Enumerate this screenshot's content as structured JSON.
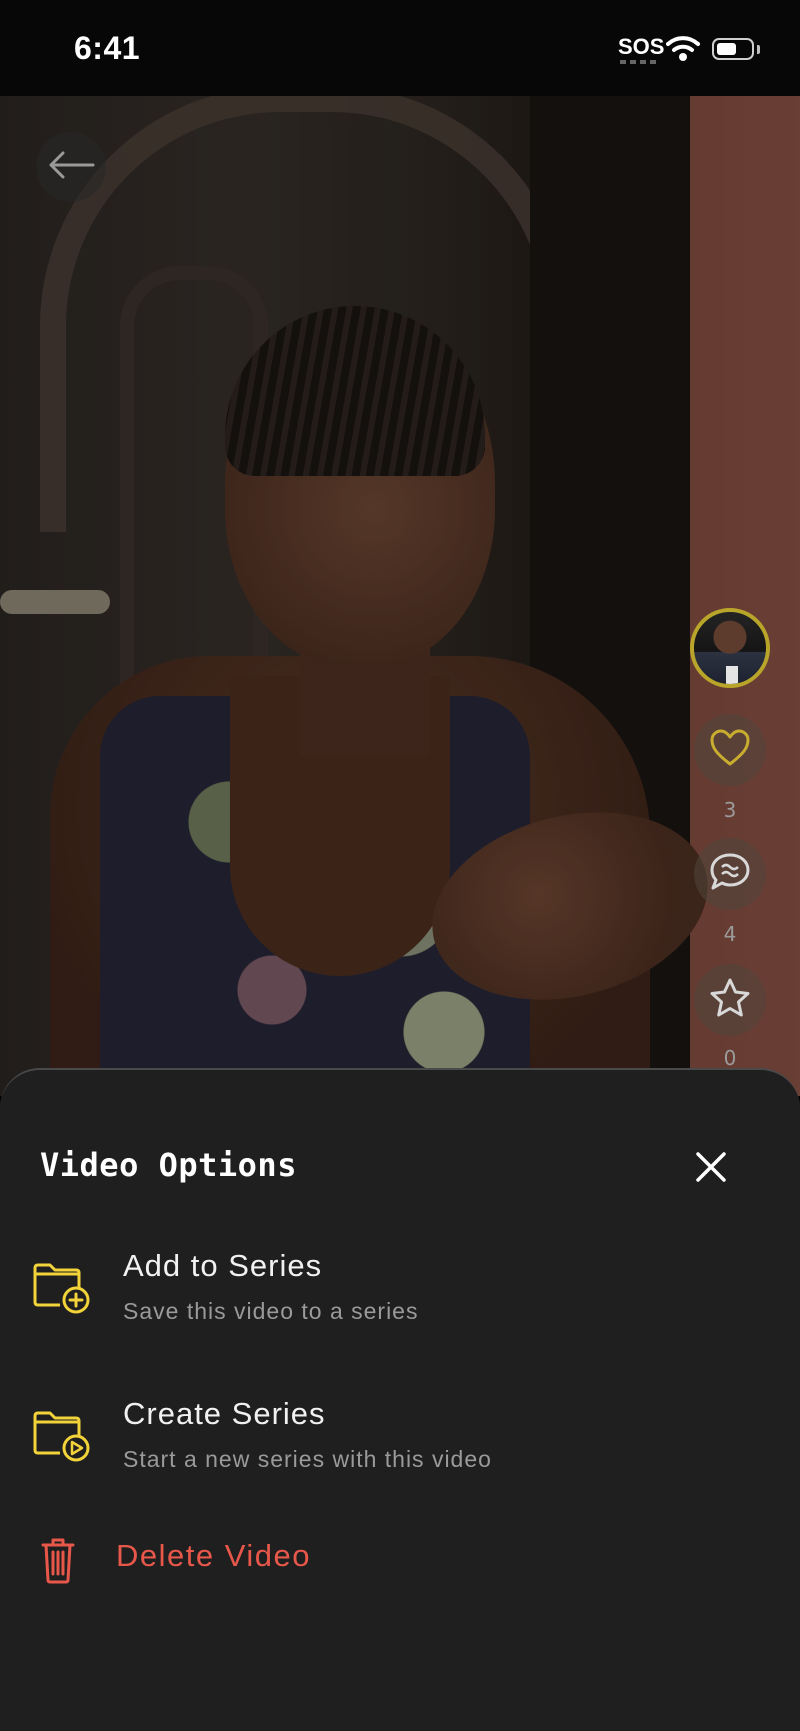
{
  "status_bar": {
    "time": "6:41",
    "sos": "SOS",
    "battery_level": 0.55
  },
  "video": {
    "side_actions": {
      "likes_count": "3",
      "comments_count": "4",
      "favorites_count": "0"
    }
  },
  "sheet": {
    "title": "Video Options",
    "options": [
      {
        "title": "Add to Series",
        "subtitle": "Save this video to a series",
        "icon": "folder-plus-icon"
      },
      {
        "title": "Create Series",
        "subtitle": "Start a new series with this video",
        "icon": "folder-play-icon"
      }
    ],
    "delete_label": "Delete Video"
  },
  "colors": {
    "accent_yellow": "#f3d33a",
    "danger_red": "#e7574a",
    "sheet_bg": "#1f1f1f"
  }
}
